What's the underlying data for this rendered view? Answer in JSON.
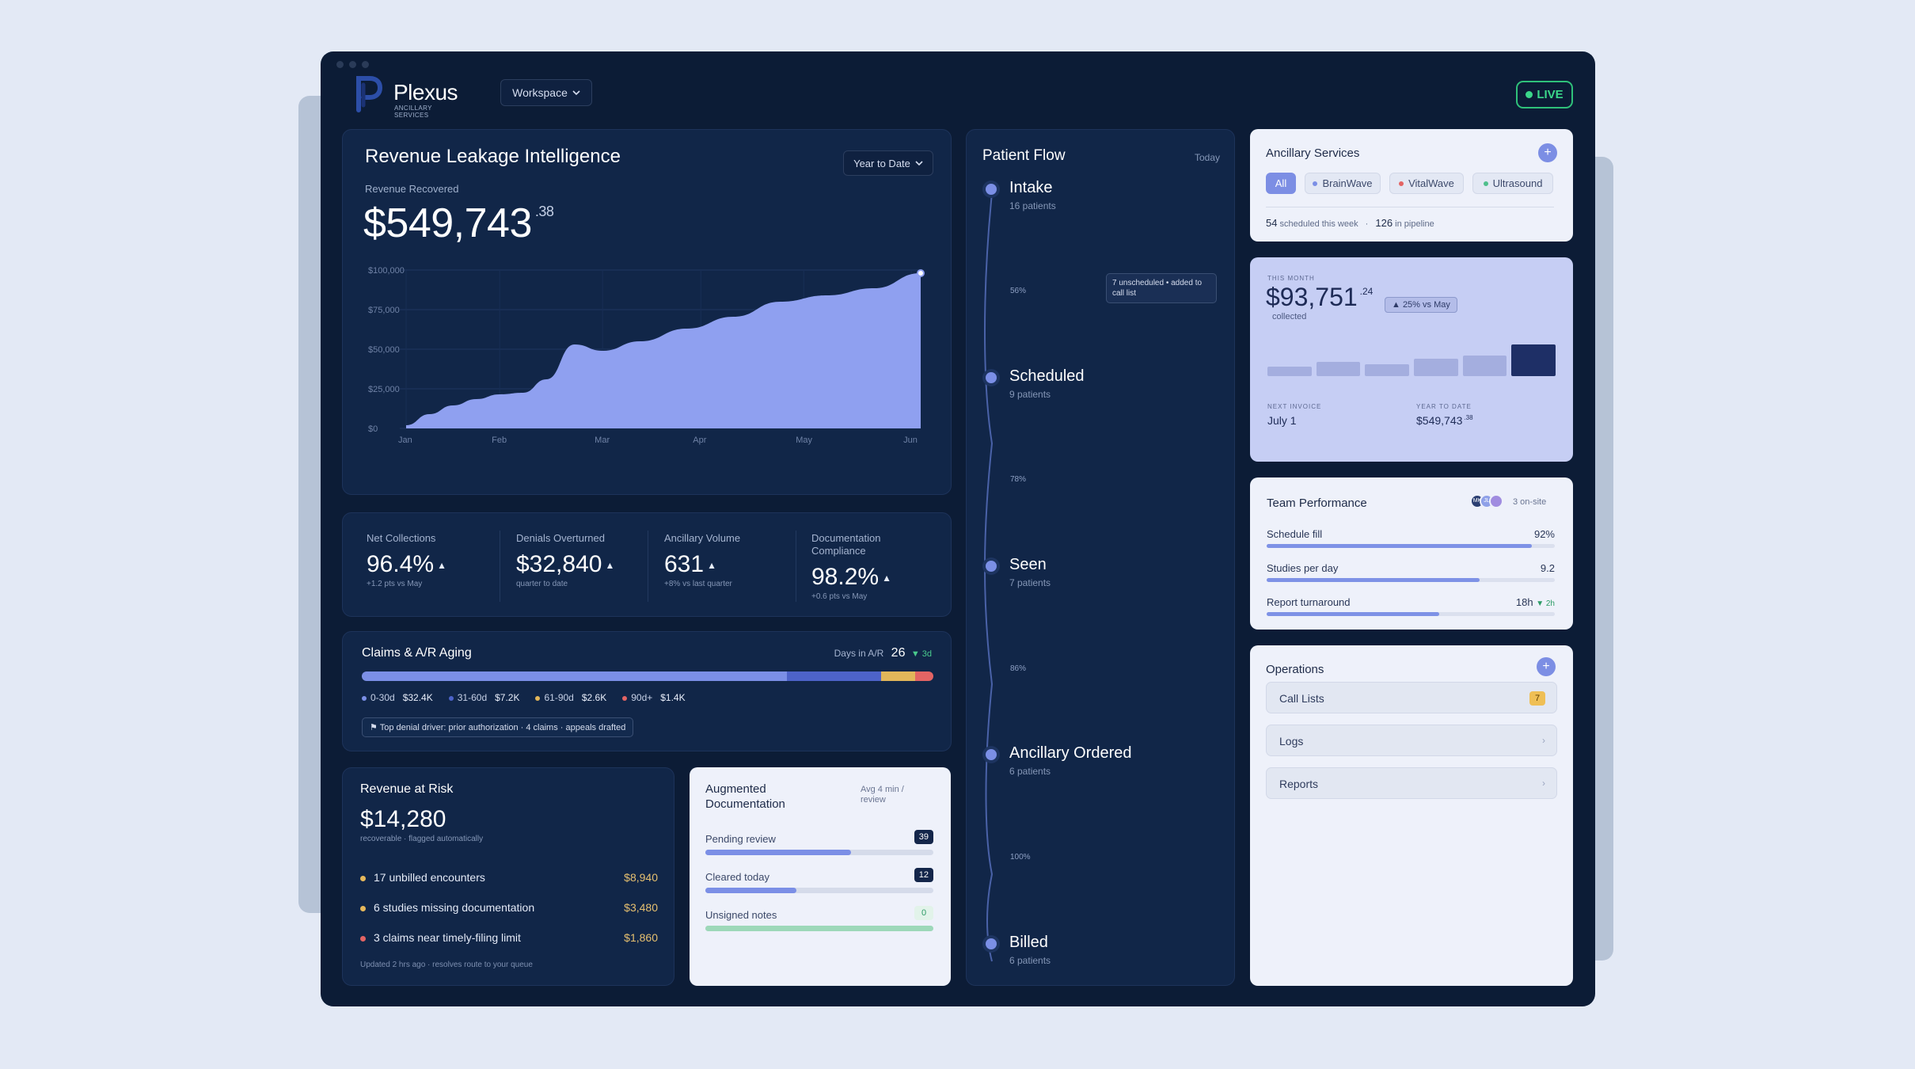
{
  "brand": {
    "name": "Plexus",
    "sub": "ANCILLARY SERVICES"
  },
  "header": {
    "workspace_label": "Workspace",
    "live_label": "LIVE"
  },
  "revenue": {
    "title": "Revenue Leakage Intelligence",
    "range_label": "Year to Date",
    "recovered_label": "Revenue Recovered",
    "recovered_value": "$549,743",
    "recovered_cents": ".38"
  },
  "chart_data": {
    "type": "area",
    "x": [
      "Jan",
      "",
      "Feb",
      "",
      "Mar",
      "",
      "",
      "Apr",
      "",
      "May",
      "",
      "Jun"
    ],
    "x_ticks": [
      "Jan",
      "Feb",
      "Mar",
      "Apr",
      "May",
      "Jun"
    ],
    "points": [
      [
        0,
        2000
      ],
      [
        0.5,
        9000
      ],
      [
        1.0,
        14500
      ],
      [
        1.5,
        18500
      ],
      [
        2.0,
        21500
      ],
      [
        2.5,
        22500
      ],
      [
        3.0,
        31000
      ],
      [
        3.6,
        53000
      ],
      [
        4.2,
        49000
      ],
      [
        5.0,
        55000
      ],
      [
        6.0,
        63000
      ],
      [
        7.0,
        70500
      ],
      [
        8.0,
        80000
      ],
      [
        9.0,
        84000
      ],
      [
        10.0,
        88500
      ],
      [
        11.0,
        98000
      ]
    ],
    "yticks": [
      "$100,000",
      "$75,000",
      "$50,000",
      "$25,000",
      "$0"
    ],
    "ylim": [
      0,
      100000
    ],
    "xlim": [
      0,
      11
    ],
    "color": "#8fa0f0"
  },
  "kpis": [
    {
      "label": "Net Collections",
      "value": "96.4%",
      "sub": "+1.2 pts vs May"
    },
    {
      "label": "Denials Overturned",
      "value": "$32,840",
      "sub": "quarter to date"
    },
    {
      "label": "Ancillary Volume",
      "value": "631",
      "sub": "+8% vs last quarter"
    },
    {
      "label": "Documentation Compliance",
      "value": "98.2%",
      "sub": "+0.6 pts vs May"
    }
  ],
  "claims": {
    "title": "Claims & A/R Aging",
    "days_label": "Days in A/R",
    "days_value": "26",
    "days_delta": "▼ 3d",
    "segments": [
      {
        "label": "0-30d",
        "amount": "$32.4K",
        "value": 32.4,
        "color": "#7b8fe6"
      },
      {
        "label": "31-60d",
        "amount": "$7.2K",
        "value": 7.2,
        "color": "#4d63c9"
      },
      {
        "label": "61-90d",
        "amount": "$2.6K",
        "value": 2.6,
        "color": "#e2b65a"
      },
      {
        "label": "90d+",
        "amount": "$1.4K",
        "value": 1.4,
        "color": "#e36464"
      }
    ],
    "driver": "⚑ Top denial driver: prior authorization · 4 claims · appeals drafted"
  },
  "risk": {
    "title": "Revenue at Risk",
    "value": "$14,280",
    "sub": "recoverable · flagged automatically",
    "items": [
      {
        "label": "17 unbilled encounters",
        "amount": "$8,940",
        "color": "#e6b85c"
      },
      {
        "label": "6 studies missing documentation",
        "amount": "$3,480",
        "color": "#e6b85c"
      },
      {
        "label": "3 claims near timely-filing limit",
        "amount": "$1,860",
        "color": "#e36464"
      }
    ],
    "footer": "Updated 2 hrs ago · resolves route to your queue"
  },
  "docs": {
    "title": "Augmented Documentation",
    "avg": "Avg 4 min / review",
    "rows": [
      {
        "label": "Pending review",
        "count": "39",
        "progress": 0.64,
        "color": "#7b8fe6"
      },
      {
        "label": "Cleared today",
        "count": "12",
        "progress": 0.4,
        "color": "#7b8fe6"
      },
      {
        "label": "Unsigned notes",
        "count": "0",
        "progress": 1.0,
        "color": "#9dd8b9"
      }
    ]
  },
  "flow": {
    "title": "Patient Flow",
    "period": "Today",
    "stages": [
      {
        "name": "Intake",
        "count": "16 patients"
      },
      {
        "name": "Scheduled",
        "count": "9 patients"
      },
      {
        "name": "Seen",
        "count": "7 patients"
      },
      {
        "name": "Ancillary Ordered",
        "count": "6 patients"
      },
      {
        "name": "Billed",
        "count": "6 patients"
      }
    ],
    "conversions": [
      "56%",
      "78%",
      "86%",
      "100%"
    ],
    "note": "7 unscheduled • added to call list"
  },
  "ancillary": {
    "title": "Ancillary Services",
    "chips": [
      {
        "label": "All",
        "color": ""
      },
      {
        "label": "BrainWave",
        "color": "#7b8fe6"
      },
      {
        "label": "VitalWave",
        "color": "#e36464"
      },
      {
        "label": "Ultrasound",
        "color": "#4fbf8c"
      }
    ],
    "scheduled_count": "54",
    "scheduled_label": "scheduled this week",
    "sep": "·",
    "pipeline_count": "126",
    "pipeline_label": "in pipeline"
  },
  "month": {
    "eyebrow": "THIS MONTH",
    "value": "$93,751",
    "cents": ".24",
    "collected": "collected",
    "delta": "▲ 25% vs May",
    "bars": [
      0.3,
      0.45,
      0.38,
      0.55,
      0.65,
      1.0
    ],
    "next_label": "NEXT INVOICE",
    "next_value": "July 1",
    "ytd_label": "YEAR TO DATE",
    "ytd_value": "$549,743",
    "ytd_cents": ".38"
  },
  "team": {
    "title": "Team Performance",
    "avatars": [
      "MK",
      "JL",
      ""
    ],
    "onsite": "3 on-site",
    "rows": [
      {
        "label": "Schedule fill",
        "value": "92%",
        "progress": 0.92
      },
      {
        "label": "Studies per day",
        "value": "9.2",
        "progress": 0.74
      },
      {
        "label": "Report turnaround",
        "value": "18h",
        "delta": "▼ 2h",
        "progress": 0.6
      }
    ]
  },
  "ops": {
    "title": "Operations",
    "items": [
      {
        "label": "Call Lists",
        "badge": "7"
      },
      {
        "label": "Logs",
        "chev": "›"
      },
      {
        "label": "Reports",
        "chev": "›"
      }
    ]
  }
}
